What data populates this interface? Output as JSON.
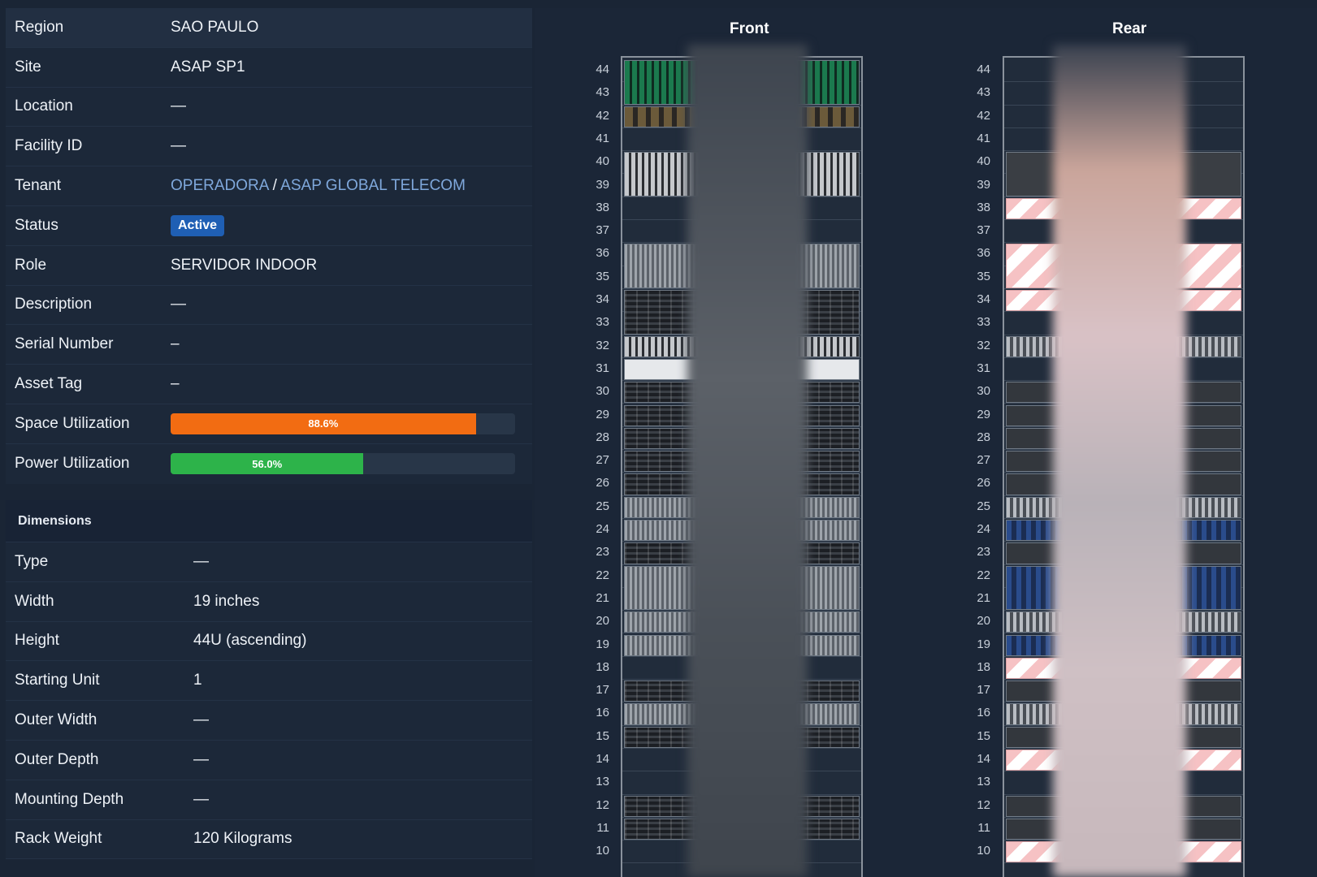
{
  "attributes": {
    "region_label": "Region",
    "region_value": "SAO PAULO",
    "site_label": "Site",
    "site_value": "ASAP SP1",
    "location_label": "Location",
    "location_value": "—",
    "facility_label": "Facility ID",
    "facility_value": "—",
    "tenant_label": "Tenant",
    "tenant_group": "OPERADORA",
    "tenant_separator": "/",
    "tenant_value": "ASAP GLOBAL TELECOM",
    "status_label": "Status",
    "status_value": "Active",
    "role_label": "Role",
    "role_value": "SERVIDOR INDOOR",
    "description_label": "Description",
    "description_value": "—",
    "serial_label": "Serial Number",
    "serial_value": "–",
    "asset_label": "Asset Tag",
    "asset_value": "–",
    "space_label": "Space Utilization",
    "space_value": "88.6%",
    "space_fraction": 0.886,
    "power_label": "Power Utilization",
    "power_value": "56.0%",
    "power_fraction": 0.56
  },
  "dimensions": {
    "header": "Dimensions",
    "type_label": "Type",
    "type_value": "—",
    "width_label": "Width",
    "width_value": "19 inches",
    "height_label": "Height",
    "height_value": "44U (ascending)",
    "starting_label": "Starting Unit",
    "starting_value": "1",
    "outer_width_label": "Outer Width",
    "outer_width_value": "—",
    "outer_depth_label": "Outer Depth",
    "outer_depth_value": "—",
    "mounting_label": "Mounting Depth",
    "mounting_value": "—",
    "weight_label": "Rack Weight",
    "weight_value": "120 Kilograms"
  },
  "rack": {
    "front_title": "Front",
    "rear_title": "Rear",
    "units": [
      44,
      43,
      42,
      41,
      40,
      39,
      38,
      37,
      36,
      35,
      34,
      33,
      32,
      31,
      30,
      29,
      28,
      27,
      26,
      25,
      24,
      23,
      22,
      21,
      20,
      19,
      18,
      17,
      16,
      15,
      14,
      13,
      12,
      11,
      10
    ]
  },
  "colors": {
    "space_bar": "#f26c12",
    "power_bar": "#2db34a",
    "link": "#7fa8dc",
    "status_badge": "#1f5fb4"
  }
}
